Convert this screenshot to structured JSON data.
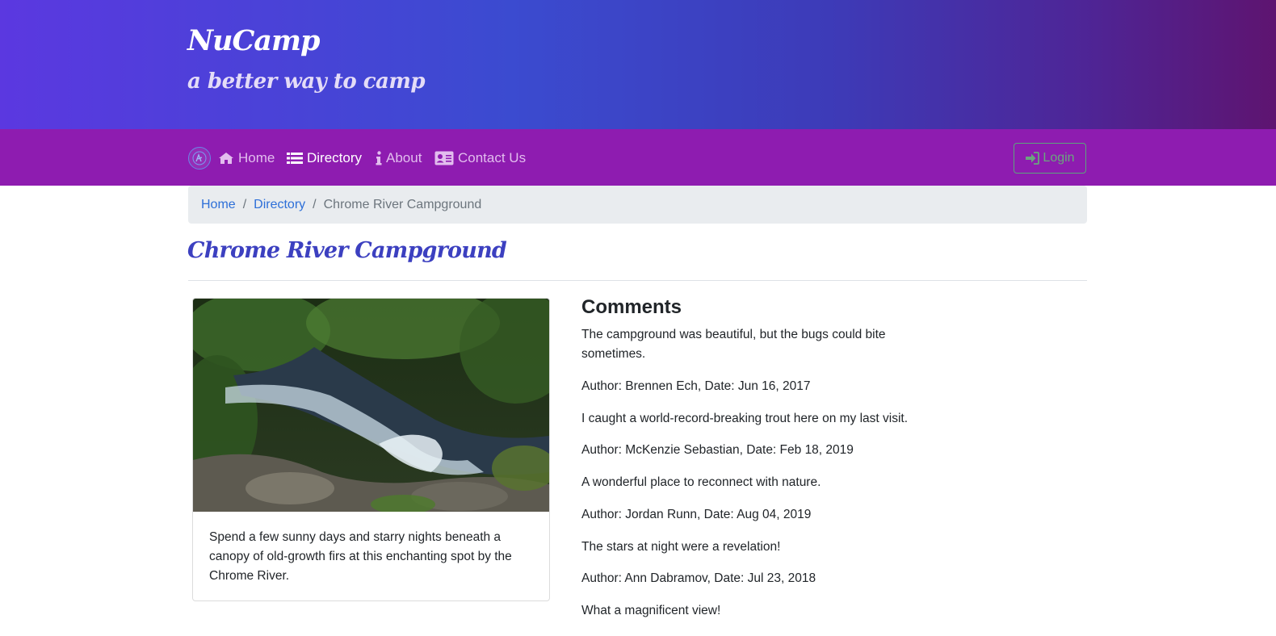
{
  "header": {
    "brand": "NuCamp",
    "tagline": "a better way to camp"
  },
  "nav": {
    "logo_icon": "nucamp-logo-icon",
    "items": [
      {
        "label": "Home",
        "icon": "home-icon",
        "active": false
      },
      {
        "label": "Directory",
        "icon": "list-icon",
        "active": true
      },
      {
        "label": "About",
        "icon": "info-icon",
        "active": false
      },
      {
        "label": "Contact Us",
        "icon": "address-card-icon",
        "active": false
      }
    ],
    "login_label": "Login"
  },
  "breadcrumb": {
    "items": [
      "Home",
      "Directory"
    ],
    "separator": "/",
    "active": "Chrome River Campground"
  },
  "campsite": {
    "name": "Chrome River Campground",
    "image_alt": "river-waterfall-photo",
    "description": "Spend a few sunny days and starry nights beneath a canopy of old-growth firs at this enchanting spot by the Chrome River."
  },
  "comments": {
    "heading": "Comments",
    "list": [
      {
        "text": "The campground was beautiful, but the bugs could bite sometimes.",
        "author_line": "Author: Brennen Ech, Date: Jun 16, 2017"
      },
      {
        "text": "I caught a world-record-breaking trout here on my last visit.",
        "author_line": "Author: McKenzie Sebastian, Date: Feb 18, 2019"
      },
      {
        "text": "A wonderful place to reconnect with nature.",
        "author_line": "Author: Jordan Runn, Date: Aug 04, 2019"
      },
      {
        "text": "The stars at night were a revelation!",
        "author_line": "Author: Ann Dabramov, Date: Jul 23, 2018"
      },
      {
        "text": "What a magnificent view!",
        "author_line": ""
      }
    ]
  },
  "colors": {
    "navbar": "#8e1cb0",
    "title": "#3c40c0",
    "link": "#2d6fd8",
    "login_border": "#5ca57c"
  }
}
